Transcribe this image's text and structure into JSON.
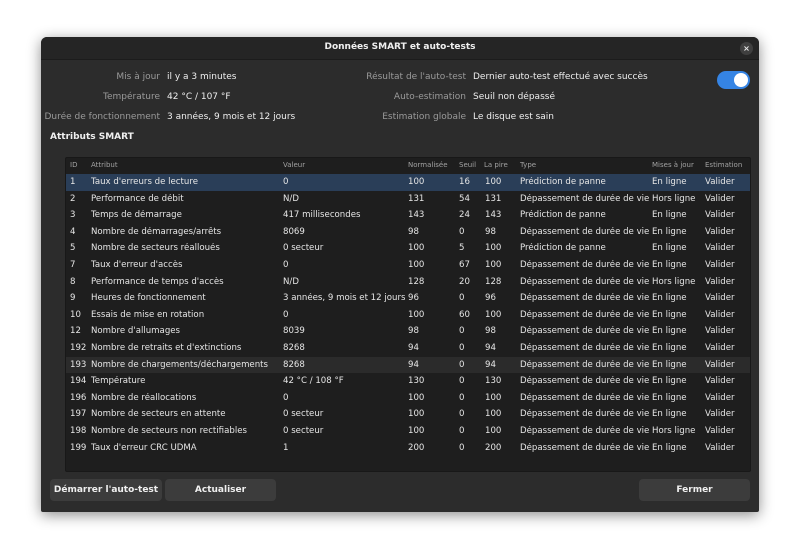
{
  "dialog": {
    "title": "Données SMART et auto-tests",
    "close_glyph": "×"
  },
  "info": {
    "updated_label": "Mis à jour",
    "updated_value": "il y a 3 minutes",
    "temperature_label": "Température",
    "temperature_value": "42 °C / 107 °F",
    "powered_label": "Durée de fonctionnement",
    "powered_value": "3 années, 9 mois et 12 jours",
    "selftest_label": "Résultat de l'auto-test",
    "selftest_value": "Dernier auto-test effectué avec succès",
    "selfassess_label": "Auto-estimation",
    "selfassess_value": "Seuil non dépassé",
    "overall_label": "Estimation globale",
    "overall_value": "Le disque est sain"
  },
  "toggle": {
    "on": true,
    "accent": "#3584e4"
  },
  "section": {
    "title": "Attributs SMART"
  },
  "table": {
    "headers": [
      "ID",
      "Attribut",
      "Valeur",
      "Normalisée",
      "Seuil",
      "La pire",
      "Type",
      "Mises à jour",
      "Estimation"
    ],
    "selected_row": 0,
    "hover_row": 11,
    "rows": [
      [
        "1",
        "Taux d'erreurs de lecture",
        "0",
        "100",
        "16",
        "100",
        "Prédiction de panne",
        "En ligne",
        "Valider"
      ],
      [
        "2",
        "Performance de débit",
        "N/D",
        "131",
        "54",
        "131",
        "Dépassement de durée de vie",
        "Hors ligne",
        "Valider"
      ],
      [
        "3",
        "Temps de démarrage",
        "417 millisecondes",
        "143",
        "24",
        "143",
        "Prédiction de panne",
        "En ligne",
        "Valider"
      ],
      [
        "4",
        "Nombre de démarrages/arrêts",
        "8069",
        "98",
        "0",
        "98",
        "Dépassement de durée de vie",
        "En ligne",
        "Valider"
      ],
      [
        "5",
        "Nombre de secteurs réalloués",
        "0 secteur",
        "100",
        "5",
        "100",
        "Prédiction de panne",
        "En ligne",
        "Valider"
      ],
      [
        "7",
        "Taux d'erreur d'accès",
        "0",
        "100",
        "67",
        "100",
        "Dépassement de durée de vie",
        "En ligne",
        "Valider"
      ],
      [
        "8",
        "Performance de temps d'accès",
        "N/D",
        "128",
        "20",
        "128",
        "Dépassement de durée de vie",
        "Hors ligne",
        "Valider"
      ],
      [
        "9",
        "Heures de fonctionnement",
        "3 années, 9 mois et 12 jours",
        "96",
        "0",
        "96",
        "Dépassement de durée de vie",
        "En ligne",
        "Valider"
      ],
      [
        "10",
        "Essais de mise en rotation",
        "0",
        "100",
        "60",
        "100",
        "Dépassement de durée de vie",
        "En ligne",
        "Valider"
      ],
      [
        "12",
        "Nombre d'allumages",
        "8039",
        "98",
        "0",
        "98",
        "Dépassement de durée de vie",
        "En ligne",
        "Valider"
      ],
      [
        "192",
        "Nombre de retraits et d'extinctions",
        "8268",
        "94",
        "0",
        "94",
        "Dépassement de durée de vie",
        "En ligne",
        "Valider"
      ],
      [
        "193",
        "Nombre de chargements/déchargements",
        "8268",
        "94",
        "0",
        "94",
        "Dépassement de durée de vie",
        "En ligne",
        "Valider"
      ],
      [
        "194",
        "Température",
        "42 °C / 108 °F",
        "130",
        "0",
        "130",
        "Dépassement de durée de vie",
        "En ligne",
        "Valider"
      ],
      [
        "196",
        "Nombre de réallocations",
        "0",
        "100",
        "0",
        "100",
        "Dépassement de durée de vie",
        "En ligne",
        "Valider"
      ],
      [
        "197",
        "Nombre de secteurs en attente",
        "0 secteur",
        "100",
        "0",
        "100",
        "Dépassement de durée de vie",
        "En ligne",
        "Valider"
      ],
      [
        "198",
        "Nombre de secteurs non rectifiables",
        "0 secteur",
        "100",
        "0",
        "100",
        "Dépassement de durée de vie",
        "Hors ligne",
        "Valider"
      ],
      [
        "199",
        "Taux d'erreur CRC UDMA",
        "1",
        "200",
        "0",
        "200",
        "Dépassement de durée de vie",
        "En ligne",
        "Valider"
      ]
    ]
  },
  "buttons": {
    "start_selftest": "Démarrer l'auto-test",
    "refresh": "Actualiser",
    "close": "Fermer"
  }
}
